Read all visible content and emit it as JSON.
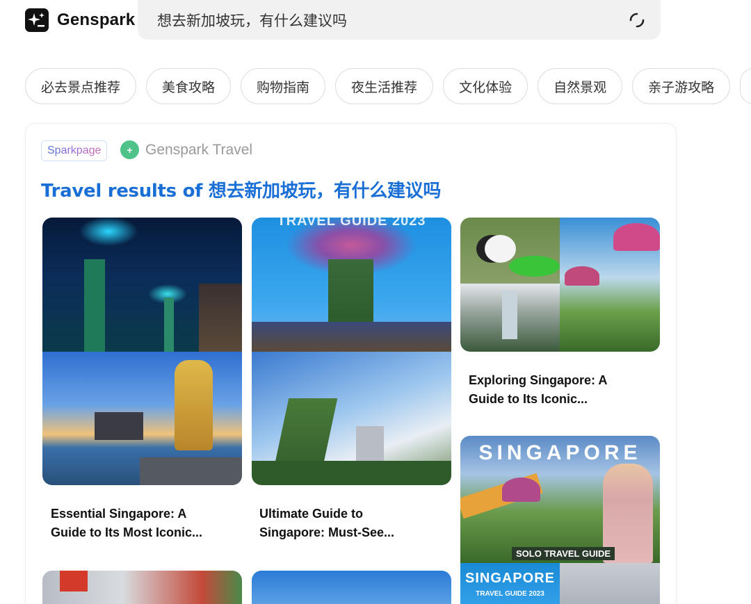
{
  "header": {
    "brand": "Genspark",
    "search_query": "想去新加坡玩，有什么建议吗"
  },
  "tags": [
    "必去景点推荐",
    "美食攻略",
    "购物指南",
    "夜生活推荐",
    "文化体验",
    "自然景观",
    "亲子游攻略"
  ],
  "card": {
    "badge": "Sparkpage",
    "source": "Genspark Travel",
    "title": "Travel results of 想去新加坡玩，有什么建议吗",
    "results": [
      {
        "caption_line1": "Essential Singapore: A",
        "caption_line2": "Guide to Its Most Iconic..."
      },
      {
        "caption_line1": "Ultimate Guide to",
        "caption_line2": "Singapore: Must-See..."
      },
      {
        "caption_line1": "Exploring Singapore: A",
        "caption_line2": "Guide to Its Iconic...",
        "overlay": ""
      },
      {
        "overlay_title": "SINGAPORE",
        "overlay_sub": "SOLO TRAVEL GUIDE",
        "overlay_title2": "SINGAPORE",
        "overlay_sub2": "TRAVEL GUIDE 2023"
      }
    ],
    "tile2_overlay": "TRAVEL GUIDE 2023"
  },
  "colors": {
    "accent": "#1a6fd6",
    "brand_green": "#4fc28a"
  }
}
